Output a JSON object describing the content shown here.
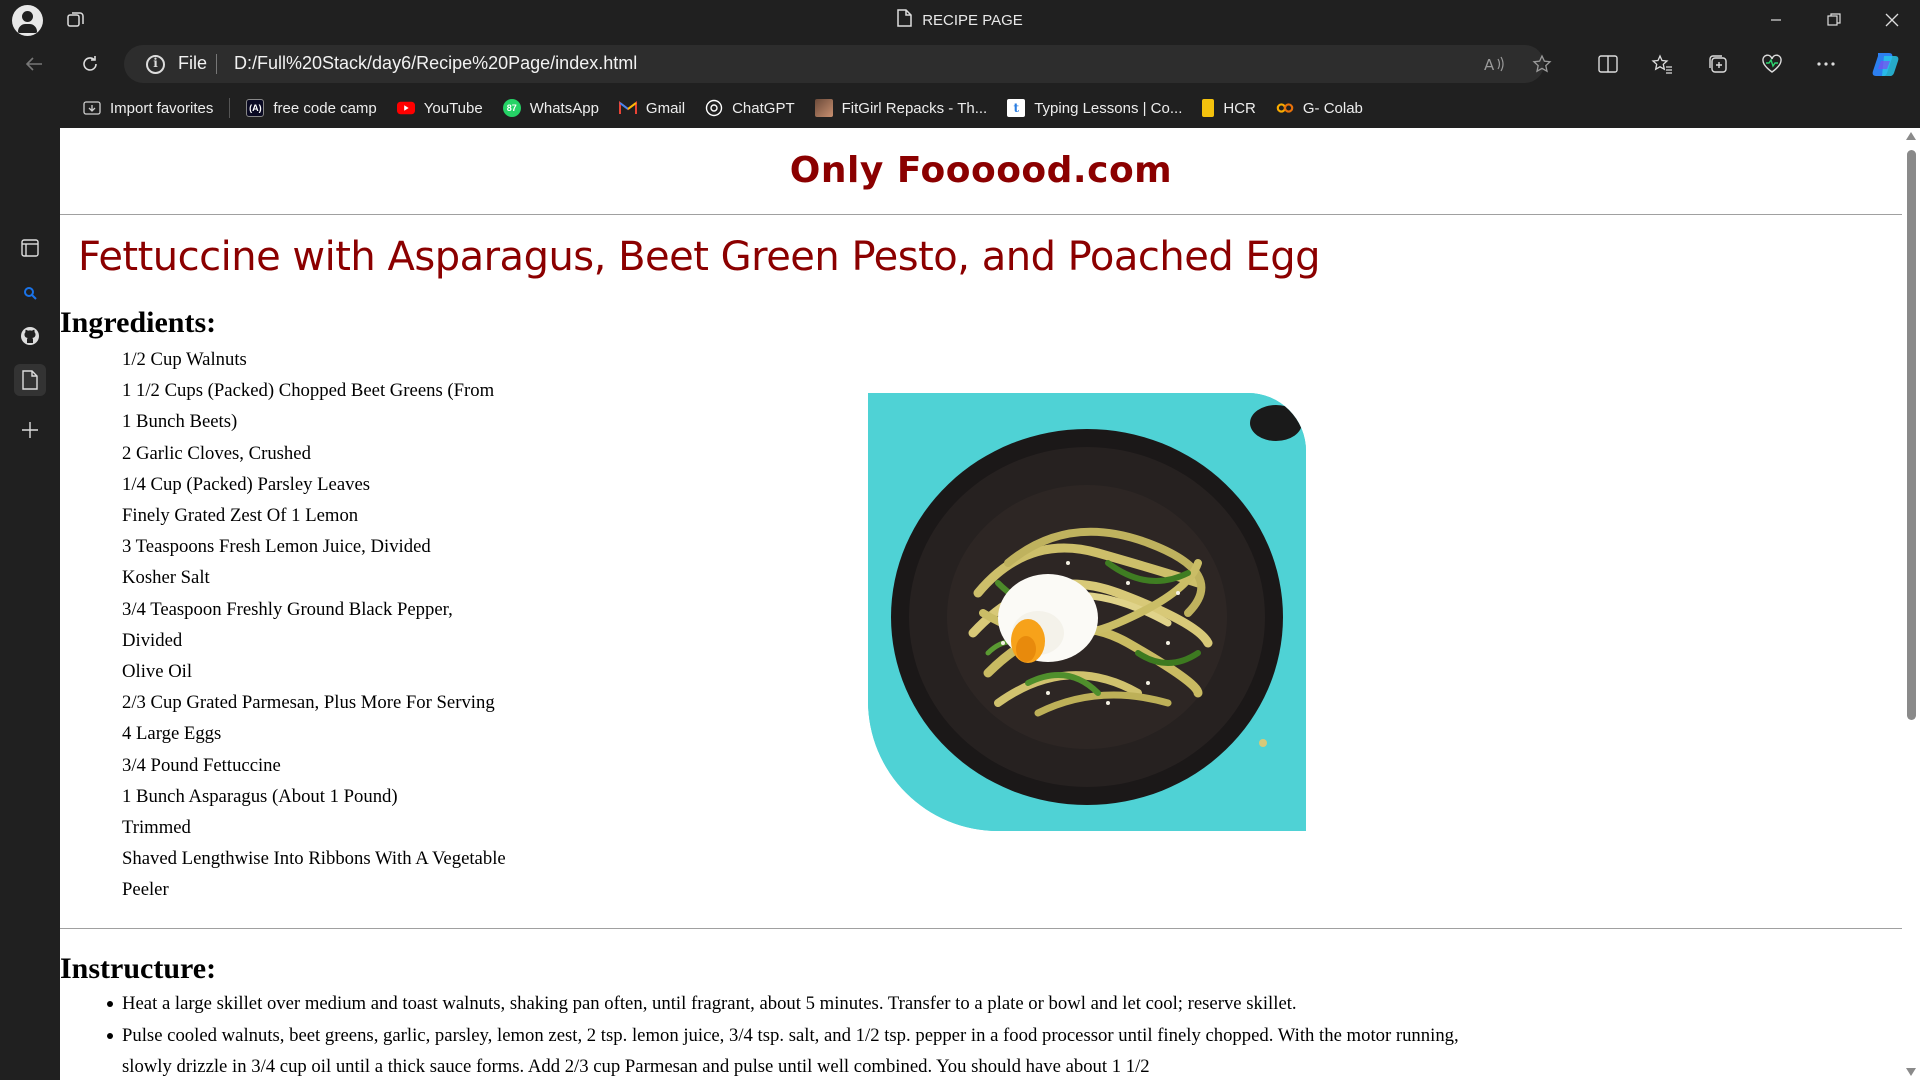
{
  "browser": {
    "tab_title": "RECIPE PAGE",
    "address": {
      "scheme_label": "File",
      "url": "D:/Full%20Stack/day6/Recipe%20Page/index.html"
    },
    "favorites": [
      {
        "label": "Import favorites",
        "icon": "import-icon",
        "color": "#cfcfcf"
      },
      {
        "label": "free code camp",
        "icon": "freecodecamp-icon",
        "color": "#ffffff"
      },
      {
        "label": "YouTube",
        "icon": "youtube-icon",
        "color": "#ff0000"
      },
      {
        "label": "WhatsApp",
        "icon": "whatsapp-icon",
        "color": "#25d366"
      },
      {
        "label": "Gmail",
        "icon": "gmail-icon",
        "color": "#ea4335"
      },
      {
        "label": "ChatGPT",
        "icon": "chatgpt-icon",
        "color": "#ffffff"
      },
      {
        "label": "FitGirl Repacks - Th...",
        "icon": "fitgirl-icon",
        "color": "#b07a5a"
      },
      {
        "label": "Typing Lessons | Co...",
        "icon": "typing-icon",
        "color": "#2a7de1"
      },
      {
        "label": "HCR",
        "icon": "hcr-icon",
        "color": "#f4c20d"
      },
      {
        "label": "G- Colab",
        "icon": "colab-icon",
        "color": "#f9ab00"
      }
    ]
  },
  "page": {
    "site_name": "Only Foooood.com",
    "recipe_title": "Fettuccine with Asparagus, Beet Green Pesto, and Poached Egg",
    "ingredients_heading": "Ingredients:",
    "ingredients": [
      "1/2 Cup Walnuts",
      "1 1/2 Cups (Packed) Chopped Beet Greens (From",
      "1 Bunch Beets)",
      "2 Garlic Cloves, Crushed",
      "1/4 Cup (Packed) Parsley Leaves",
      "Finely Grated Zest Of 1 Lemon",
      "3 Teaspoons Fresh Lemon Juice, Divided",
      "Kosher Salt",
      "3/4 Teaspoon Freshly Ground Black Pepper,",
      "Divided",
      "Olive Oil",
      "2/3 Cup Grated Parmesan, Plus More For Serving",
      "4 Large Eggs",
      "3/4 Pound Fettuccine",
      "1 Bunch Asparagus (About 1 Pound)",
      "Trimmed",
      "Shaved Lengthwise Into Ribbons With A Vegetable",
      "Peeler"
    ],
    "instructions_heading": "Instructure:",
    "instructions": [
      "Heat a large skillet over medium and toast walnuts, shaking pan often, until fragrant, about 5 minutes. Transfer to a plate or bowl and let cool; reserve skillet.",
      "Pulse cooled walnuts, beet greens, garlic, parsley, lemon zest, 2 tsp. lemon juice, 3/4 tsp. salt, and 1/2 tsp. pepper in a food processor until finely chopped. With the motor running, slowly drizzle in 3/4 cup oil until a thick sauce forms. Add 2/3 cup Parmesan and pulse until well combined. You should have about 1 1/2"
    ],
    "colors": {
      "accent": "#8b0000",
      "image_background": "#4dd0d3"
    }
  }
}
